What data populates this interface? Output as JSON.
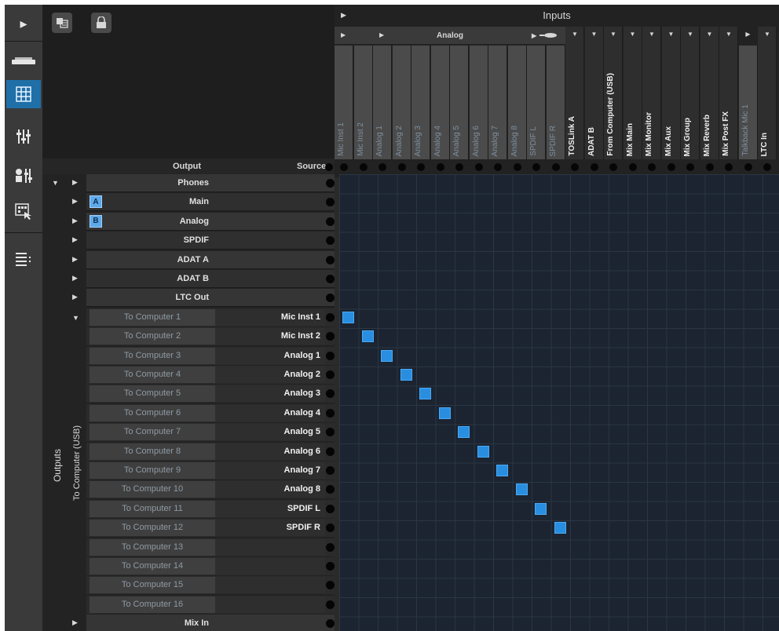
{
  "sidebar": {
    "items": [
      {
        "icon": "play-arrow-icon"
      },
      {
        "icon": "device-icon"
      },
      {
        "icon": "routing-grid-icon",
        "active": true
      },
      {
        "icon": "mixer-faders-icon"
      },
      {
        "icon": "mixer-settings-icon"
      },
      {
        "icon": "touch-panel-icon"
      },
      {
        "icon": "list-menu-icon"
      }
    ]
  },
  "toolbar": {
    "buttons": [
      {
        "icon": "window-layout-icon"
      },
      {
        "icon": "lock-icon"
      }
    ]
  },
  "inputs": {
    "title": "Inputs",
    "groups": {
      "analog": "Analog"
    },
    "columns": [
      "Mic Inst 1",
      "Mic Inst 2",
      "Analog 1",
      "Analog 2",
      "Analog 3",
      "Analog 4",
      "Analog 5",
      "Analog 6",
      "Analog 7",
      "Analog 8",
      "SPDIF L",
      "SPDIF R",
      "TOSLink A",
      "ADAT B",
      "From Computer (USB)",
      "Mix Main",
      "Mix Monitor",
      "Mix Aux",
      "Mix Group",
      "Mix Reverb",
      "Mix Post FX",
      "Talkback Mic 1",
      "LTC In"
    ]
  },
  "outputs": {
    "panel_label": "Outputs",
    "sub_label": "To Computer (USB)",
    "header_output": "Output",
    "header_source": "Source",
    "groups": [
      {
        "name": "Phones"
      },
      {
        "name": "Main",
        "badge": "A"
      },
      {
        "name": "Analog",
        "badge": "B"
      },
      {
        "name": "SPDIF"
      },
      {
        "name": "ADAT A"
      },
      {
        "name": "ADAT B"
      },
      {
        "name": "LTC Out"
      }
    ],
    "channels": [
      {
        "name": "To Computer 1",
        "source": "Mic Inst 1"
      },
      {
        "name": "To Computer 2",
        "source": "Mic Inst 2"
      },
      {
        "name": "To Computer 3",
        "source": "Analog 1"
      },
      {
        "name": "To Computer 4",
        "source": "Analog 2"
      },
      {
        "name": "To Computer 5",
        "source": "Analog 3"
      },
      {
        "name": "To Computer 6",
        "source": "Analog 4"
      },
      {
        "name": "To Computer 7",
        "source": "Analog 5"
      },
      {
        "name": "To Computer 8",
        "source": "Analog 6"
      },
      {
        "name": "To Computer 9",
        "source": "Analog 7"
      },
      {
        "name": "To Computer 10",
        "source": "Analog 8"
      },
      {
        "name": "To Computer 11",
        "source": "SPDIF L"
      },
      {
        "name": "To Computer 12",
        "source": "SPDIF R"
      },
      {
        "name": "To Computer 13",
        "source": ""
      },
      {
        "name": "To Computer 14",
        "source": ""
      },
      {
        "name": "To Computer 15",
        "source": ""
      },
      {
        "name": "To Computer 16",
        "source": ""
      }
    ],
    "footer_group": "Mix In"
  },
  "colors": {
    "accent": "#2a8ee0",
    "badge": "#5fa9e8",
    "matrix_bg": "#1b2430"
  }
}
